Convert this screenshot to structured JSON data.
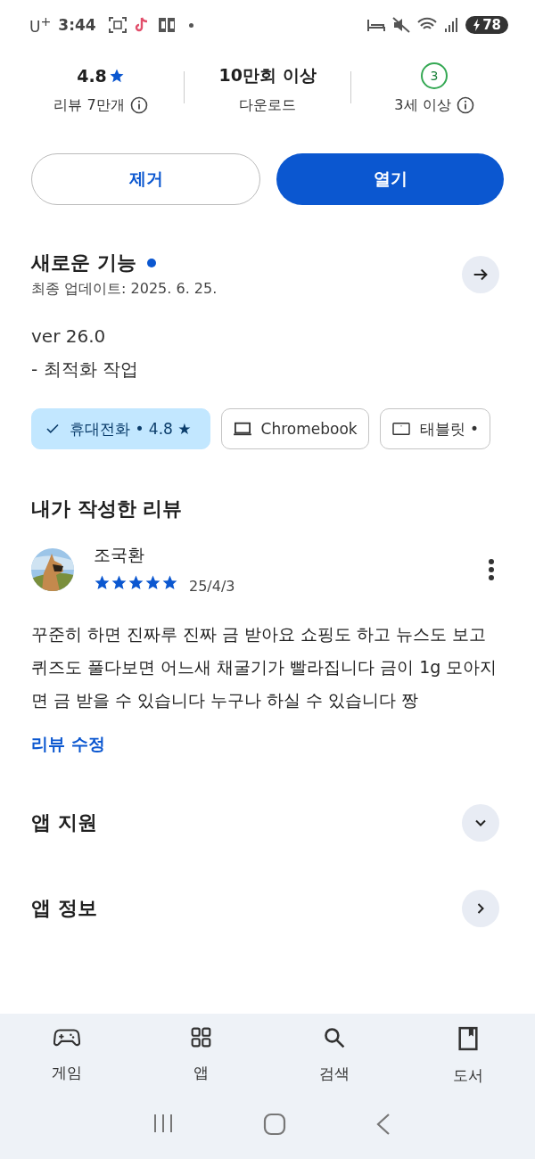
{
  "status_bar": {
    "carrier": "U$^{+}$",
    "time": "3:44",
    "battery": "78"
  },
  "stats": [
    {
      "kind": "rating",
      "value": "4.8",
      "label": "리뷰 7만개",
      "info": true
    },
    {
      "kind": "text",
      "value": "10만회 이상",
      "label": "다운로드",
      "info": false
    },
    {
      "kind": "age",
      "value": "3",
      "label": "3세 이상",
      "info": true
    }
  ],
  "buttons": [
    {
      "label": "제거",
      "kind": "outline"
    },
    {
      "label": "열기",
      "kind": "filled"
    }
  ],
  "whats_new": {
    "title": "새로운 기능",
    "unread": true,
    "updated": "최종 업데이트: 2025. 6. 25.",
    "version": "ver 26.0",
    "notes": "- 최적화 작업"
  },
  "devices": [
    {
      "label": "휴대전화 • 4.8 ★",
      "selected": true
    },
    {
      "label": "Chromebook",
      "kind": "laptop",
      "selected": false
    },
    {
      "label": "태블릿 •",
      "kind": "tablet",
      "selected": false
    }
  ],
  "my_review": {
    "heading": "내가 작성한 리뷰",
    "author": "조국환",
    "stars": 5,
    "date": "25/4/3",
    "text": "꾸준히 하면 진짜루 진짜 금 받아요 쇼핑도 하고 뉴스도 보고 퀴즈도 풀다보면 어느새 채굴기가 빨라집니다 금이 1g 모아지면 금 받을 수 있습니다 누구나 하실 수 있습니다 짱",
    "edit": "리뷰 수정"
  },
  "sections": [
    {
      "title": "앱 지원",
      "kind": "expand"
    },
    {
      "title": "앱 정보",
      "kind": "arrow"
    }
  ],
  "bottom_nav": [
    {
      "label": "게임",
      "kind": "game",
      "selected": false
    },
    {
      "label": "앱",
      "kind": "apps",
      "selected": false
    },
    {
      "label": "검색",
      "kind": "search",
      "selected": false
    },
    {
      "label": "도서",
      "kind": "book",
      "selected": false
    }
  ]
}
